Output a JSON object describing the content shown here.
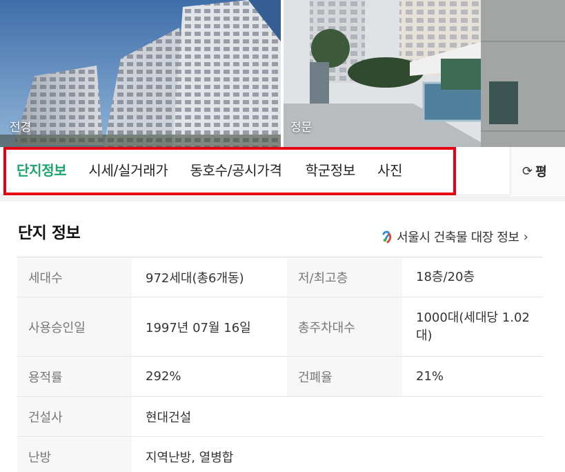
{
  "photos": [
    {
      "caption": "전경"
    },
    {
      "caption": "정문"
    }
  ],
  "tabs": [
    {
      "label": "단지정보",
      "active": true
    },
    {
      "label": "시세/실거래가",
      "active": false
    },
    {
      "label": "동호수/공시가격",
      "active": false
    },
    {
      "label": "학군정보",
      "active": false
    },
    {
      "label": "사진",
      "active": false
    }
  ],
  "unit_toggle": {
    "label": "평",
    "icon": "refresh-icon"
  },
  "section": {
    "title": "단지 정보",
    "registry_link": "서울시 건축물 대장 정보"
  },
  "info": {
    "households_label": "세대수",
    "households_value": "972세대(총6개동)",
    "floors_label": "저/최고층",
    "floors_value": "18층/20층",
    "approval_label": "사용승인일",
    "approval_value": "1997년 07월 16일",
    "parking_label": "총주차대수",
    "parking_value": "1000대(세대당 1.02대)",
    "far_label": "용적률",
    "far_value": "292%",
    "bcr_label": "건폐율",
    "bcr_value": "21%",
    "builder_label": "건설사",
    "builder_value": "현대건설",
    "heating_label": "난방",
    "heating_value": "지역난방, 열병합"
  },
  "colors": {
    "active_tab": "#1aa56c",
    "highlight_border": "#e60012"
  }
}
